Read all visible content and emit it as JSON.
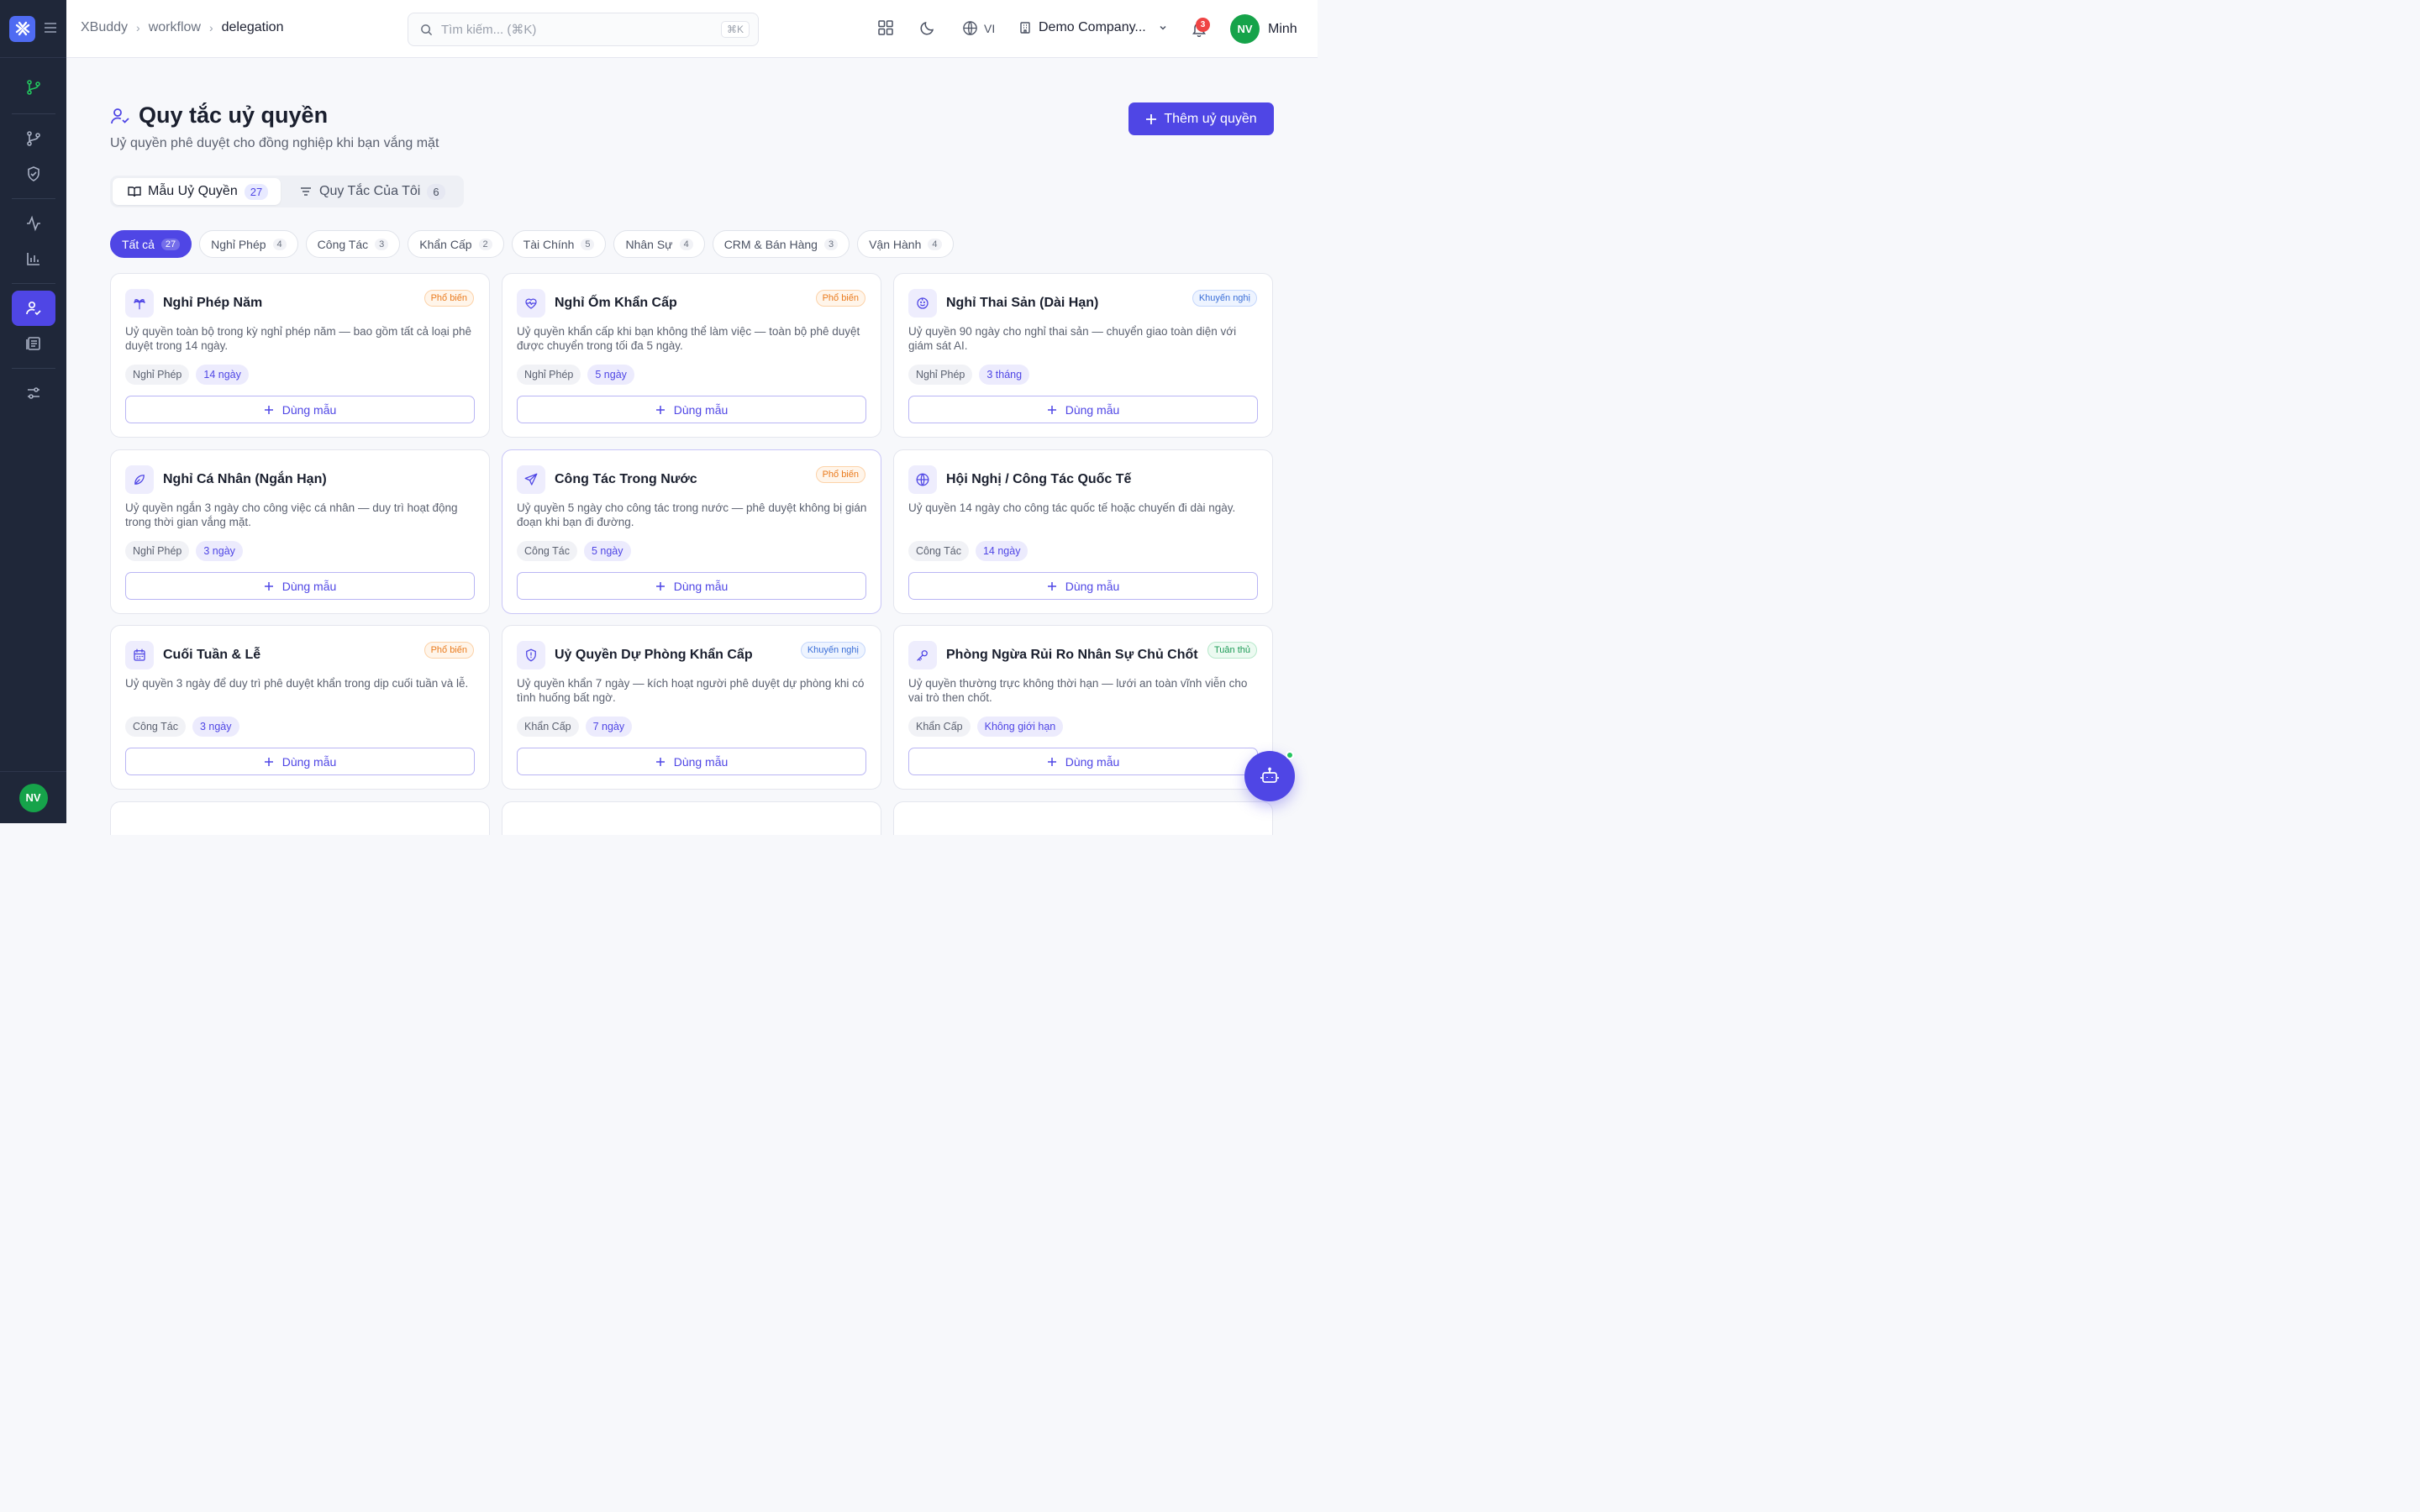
{
  "breadcrumb": [
    "XBuddy",
    "workflow",
    "delegation"
  ],
  "search": {
    "placeholder": "Tìm kiếm... (⌘K)",
    "shortcut": "⌘K"
  },
  "topbar": {
    "lang": "VI",
    "company": "Demo Company...",
    "notifications": "3",
    "user_initials": "NV",
    "user_name": "Minh"
  },
  "sidebar": {
    "avatar_initials": "NV"
  },
  "page": {
    "title": "Quy tắc uỷ quyền",
    "subtitle": "Uỷ quyền phê duyệt cho đồng nghiệp khi bạn vắng mặt",
    "add_button": "Thêm uỷ quyền"
  },
  "tabs": [
    {
      "label": "Mẫu Uỷ Quyền",
      "count": "27"
    },
    {
      "label": "Quy Tắc Của Tôi",
      "count": "6"
    }
  ],
  "filters": [
    {
      "label": "Tất cả",
      "count": "27"
    },
    {
      "label": "Nghỉ Phép",
      "count": "4"
    },
    {
      "label": "Công Tác",
      "count": "3"
    },
    {
      "label": "Khẩn Cấp",
      "count": "2"
    },
    {
      "label": "Tài Chính",
      "count": "5"
    },
    {
      "label": "Nhân Sự",
      "count": "4"
    },
    {
      "label": "CRM & Bán Hàng",
      "count": "3"
    },
    {
      "label": "Vận Hành",
      "count": "4"
    }
  ],
  "use_label": "Dùng mẫu",
  "cards": [
    {
      "title": "Nghỉ Phép Năm",
      "badge": "Phổ biến",
      "desc": "Uỷ quyền toàn bộ trong kỳ nghỉ phép năm — bao gồm tất cả loại phê duyệt trong 14 ngày.",
      "category": "Nghỉ Phép",
      "duration": "14 ngày"
    },
    {
      "title": "Nghỉ Ốm Khẩn Cấp",
      "badge": "Phổ biến",
      "desc": "Uỷ quyền khẩn cấp khi bạn không thể làm việc — toàn bộ phê duyệt được chuyển trong tối đa 5 ngày.",
      "category": "Nghỉ Phép",
      "duration": "5 ngày"
    },
    {
      "title": "Nghỉ Thai Sản (Dài Hạn)",
      "badge": "Khuyến nghị",
      "desc": "Uỷ quyền 90 ngày cho nghỉ thai sản — chuyển giao toàn diện với giám sát AI.",
      "category": "Nghỉ Phép",
      "duration": "3 tháng"
    },
    {
      "title": "Nghỉ Cá Nhân (Ngắn Hạn)",
      "badge": "",
      "desc": "Uỷ quyền ngắn 3 ngày cho công việc cá nhân — duy trì hoạt động trong thời gian vắng mặt.",
      "category": "Nghỉ Phép",
      "duration": "3 ngày"
    },
    {
      "title": "Công Tác Trong Nước",
      "badge": "Phổ biến",
      "desc": "Uỷ quyền 5 ngày cho công tác trong nước — phê duyệt không bị gián đoạn khi bạn đi đường.",
      "category": "Công Tác",
      "duration": "5 ngày"
    },
    {
      "title": "Hội Nghị / Công Tác Quốc Tế",
      "badge": "",
      "desc": "Uỷ quyền 14 ngày cho công tác quốc tế hoặc chuyến đi dài ngày.",
      "category": "Công Tác",
      "duration": "14 ngày"
    },
    {
      "title": "Cuối Tuần & Lễ",
      "badge": "Phổ biến",
      "desc": "Uỷ quyền 3 ngày để duy trì phê duyệt khẩn trong dịp cuối tuần và lễ.",
      "category": "Công Tác",
      "duration": "3 ngày"
    },
    {
      "title": "Uỷ Quyền Dự Phòng Khẩn Cấp",
      "badge": "Khuyến nghị",
      "desc": "Uỷ quyền khẩn 7 ngày — kích hoạt người phê duyệt dự phòng khi có tình huống bất ngờ.",
      "category": "Khẩn Cấp",
      "duration": "7 ngày"
    },
    {
      "title": "Phòng Ngừa Rủi Ro Nhân Sự Chủ Chốt",
      "badge": "Tuân thủ",
      "desc": "Uỷ quyền thường trực không thời hạn — lưới an toàn vĩnh viễn cho vai trò then chốt.",
      "category": "Khẩn Cấp",
      "duration": "Không giới hạn"
    }
  ],
  "colors": {
    "accent": "#4f46e5",
    "sidebar": "#1f2739",
    "badge_popular": "#ea7b1d",
    "badge_recommended": "#3b6fd8",
    "badge_compliance": "#1b9a55"
  }
}
